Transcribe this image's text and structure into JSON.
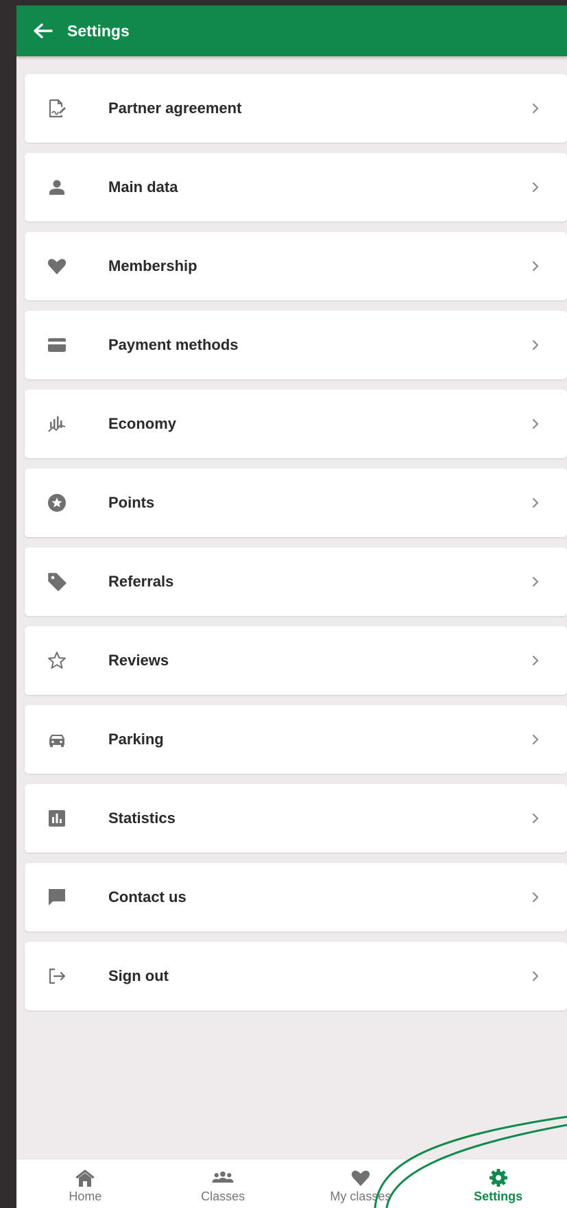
{
  "app_bar": {
    "title": "Settings",
    "back_icon": "arrow-left-icon"
  },
  "colors": {
    "brand_green": "#10894c",
    "background": "#edebeb",
    "icon_gray": "#707070",
    "text_dark": "#2a2a2a"
  },
  "menu": {
    "items": [
      {
        "label": "Partner agreement",
        "icon": "document-sign-icon"
      },
      {
        "label": "Main data",
        "icon": "person-icon"
      },
      {
        "label": "Membership",
        "icon": "heart-icon"
      },
      {
        "label": "Payment methods",
        "icon": "credit-card-icon"
      },
      {
        "label": "Economy",
        "icon": "economy-chart-icon"
      },
      {
        "label": "Points",
        "icon": "star-badge-icon"
      },
      {
        "label": "Referrals",
        "icon": "tag-icon"
      },
      {
        "label": "Reviews",
        "icon": "star-outline-icon"
      },
      {
        "label": "Parking",
        "icon": "car-icon"
      },
      {
        "label": "Statistics",
        "icon": "bar-chart-icon"
      },
      {
        "label": "Contact us",
        "icon": "chat-icon"
      },
      {
        "label": "Sign out",
        "icon": "sign-out-icon"
      }
    ]
  },
  "bottom_nav": {
    "items": [
      {
        "label": "Home",
        "icon": "home-icon"
      },
      {
        "label": "Classes",
        "icon": "group-icon"
      },
      {
        "label": "My classes",
        "icon": "heart-icon"
      },
      {
        "label": "Settings",
        "icon": "gear-icon",
        "active": true
      }
    ]
  }
}
